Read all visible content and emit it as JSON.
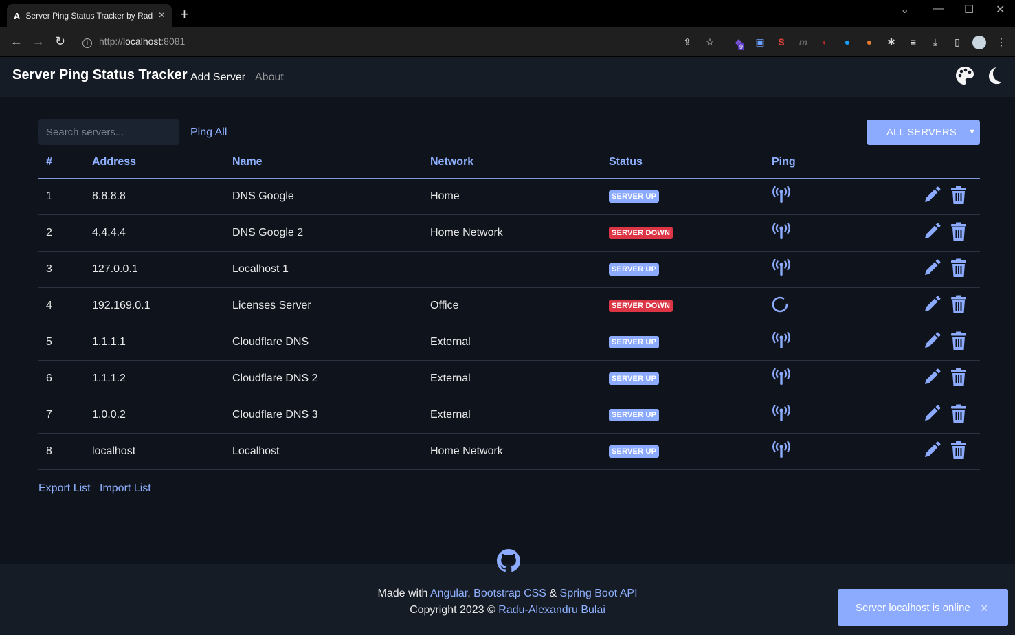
{
  "browser": {
    "tab_title": "Server Ping Status Tracker by Rad",
    "url_scheme": "http://",
    "url_host": "localhost",
    "url_port": ":8081",
    "ext_badge": "9"
  },
  "navbar": {
    "brand": "Server Ping Status Tracker",
    "links": [
      "Add Server",
      "About"
    ]
  },
  "controls": {
    "search_placeholder": "Search servers...",
    "ping_all": "Ping All",
    "filter_selected": "ALL SERVERS"
  },
  "table": {
    "headers": [
      "#",
      "Address",
      "Name",
      "Network",
      "Status",
      "Ping"
    ],
    "rows": [
      {
        "num": "1",
        "address": "8.8.8.8",
        "name": "DNS Google",
        "network": "Home",
        "status": "SERVER UP",
        "state": "up",
        "ping": "signal"
      },
      {
        "num": "2",
        "address": "4.4.4.4",
        "name": "DNS Google 2",
        "network": "Home Network",
        "status": "SERVER DOWN",
        "state": "down",
        "ping": "signal"
      },
      {
        "num": "3",
        "address": "127.0.0.1",
        "name": "Localhost 1",
        "network": "",
        "status": "SERVER UP",
        "state": "up",
        "ping": "signal"
      },
      {
        "num": "4",
        "address": "192.169.0.1",
        "name": "Licenses Server",
        "network": "Office",
        "status": "SERVER DOWN",
        "state": "down",
        "ping": "spinner"
      },
      {
        "num": "5",
        "address": "1.1.1.1",
        "name": "Cloudflare DNS",
        "network": "External",
        "status": "SERVER UP",
        "state": "up",
        "ping": "signal"
      },
      {
        "num": "6",
        "address": "1.1.1.2",
        "name": "Cloudflare DNS 2",
        "network": "External",
        "status": "SERVER UP",
        "state": "up",
        "ping": "signal"
      },
      {
        "num": "7",
        "address": "1.0.0.2",
        "name": "Cloudflare DNS 3",
        "network": "External",
        "status": "SERVER UP",
        "state": "up",
        "ping": "signal"
      },
      {
        "num": "8",
        "address": "localhost",
        "name": "Localhost",
        "network": "Home Network",
        "status": "SERVER UP",
        "state": "up",
        "ping": "signal"
      }
    ]
  },
  "list_actions": {
    "export": "Export List",
    "import": "Import List"
  },
  "footer": {
    "made_with": "Made with",
    "angular": "Angular",
    "comma": ",",
    "bootstrap": "Bootstrap CSS",
    "amp": "&",
    "spring": "Spring Boot API",
    "copyright": "Copyright 2023 ©",
    "author": "Radu-Alexandru Bulai"
  },
  "toast": {
    "message": "Server localhost is online",
    "close": "×"
  },
  "colors": {
    "accent": "#8cabff",
    "danger": "#dc3545",
    "background": "#0f141c",
    "navbar": "#161c26"
  }
}
